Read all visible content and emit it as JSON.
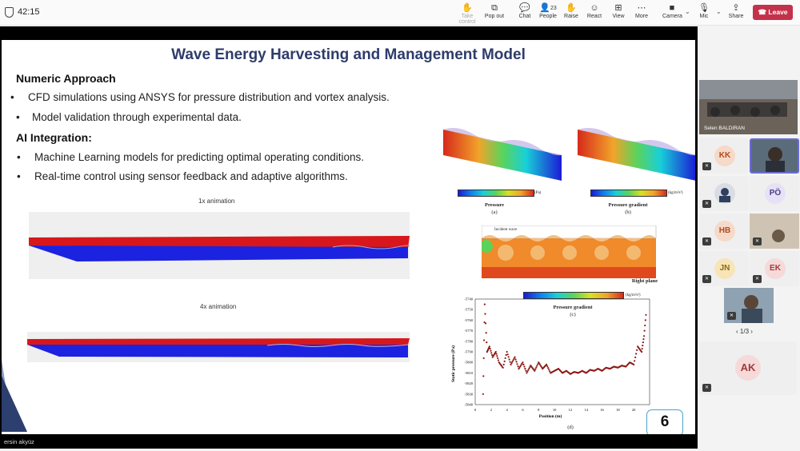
{
  "topbar": {
    "timer": "42:15",
    "take_control": "Take control",
    "pop_out": "Pop out",
    "chat": "Chat",
    "people": "People",
    "people_count": "23",
    "raise": "Raise",
    "react": "React",
    "view": "View",
    "more": "More",
    "camera": "Camera",
    "mic": "Mic",
    "share": "Share",
    "leave": "Leave"
  },
  "slide": {
    "title": "Wave Energy Harvesting and Management Model",
    "section1": "Numeric Approach",
    "bullets1": [
      "CFD simulations using ANSYS for pressure distribution and vortex analysis.",
      "Model validation through experimental data."
    ],
    "section2": "AI Integration:",
    "bullets2": [
      "Machine Learning models for predicting optimal operating conditions.",
      "Real-time control using sensor feedback and adaptive algorithms."
    ],
    "anim1_label": "1x animation",
    "anim2_label": "4x animation",
    "page_number": "6",
    "figure": {
      "pressure_caption": "Pressure",
      "pressure_sub": "(a)",
      "pressure_unit": "(Pa)",
      "gradient_caption": "Pressure gradient",
      "gradient_sub": "(b)",
      "gradient_unit": "(kg/m²s²)",
      "incident_wave": "Incident wave",
      "right_plane": "Right plane",
      "gradient_caption_c": "Pressure gradient",
      "sub_c": "(c)",
      "unit_c": "(kg/m²s²)",
      "y_label": "Static pressure (Pa)",
      "x_label": "Position (m)",
      "sub_d": "(d)",
      "y_ticks": [
        "-5740",
        "-5750",
        "-5760",
        "-5770",
        "-5780",
        "-5790",
        "-5800",
        "-5810",
        "-5820",
        "-5830",
        "-5840"
      ],
      "x_ticks": [
        "0",
        "2",
        "4",
        "6",
        "8",
        "10",
        "12",
        "14",
        "16",
        "18",
        "20"
      ]
    }
  },
  "presenter_name": "ersin akyüz",
  "participants": {
    "main_video_name": "Selen BALDIRAN",
    "tiles": [
      {
        "initials": "KK",
        "bg": "#f6d9c8",
        "fg": "#b04a1e"
      },
      {
        "initials": "PÖ",
        "bg": "#e6e1f5",
        "fg": "#4b3d8f"
      },
      {
        "initials": "HB",
        "bg": "#f6d9c8",
        "fg": "#b04a1e"
      },
      {
        "initials": "JN",
        "bg": "#f7e5b8",
        "fg": "#8a6a12"
      },
      {
        "initials": "EK",
        "bg": "#f6d9d9",
        "fg": "#a33a3a"
      },
      {
        "initials": "AK",
        "bg": "#f6d9d9",
        "fg": "#a33a3a"
      }
    ],
    "pager": "1/3"
  },
  "chart_data": {
    "type": "scatter",
    "xlabel": "Position (m)",
    "ylabel": "Static pressure (Pa)",
    "xlim": [
      0,
      22
    ],
    "ylim": [
      -5840,
      -5740
    ],
    "series": [
      {
        "x": [
          1.0,
          1.2,
          1.5,
          1.8,
          2.2,
          2.6,
          3.0,
          3.5,
          4.0,
          4.5,
          5.0,
          5.5,
          6.0,
          6.5,
          7.0,
          7.5,
          8.0,
          8.5,
          9.0,
          9.5,
          10.0,
          10.5,
          11.0,
          11.5,
          12.0,
          12.5,
          13.0,
          13.5,
          14.0,
          14.5,
          15.0,
          15.5,
          16.0,
          16.5,
          17.0,
          17.5,
          18.0,
          18.5,
          19.0,
          19.5,
          20.0,
          20.5,
          21.0,
          21.3,
          21.6
        ],
        "y": [
          -5830,
          -5745,
          -5790,
          -5785,
          -5795,
          -5790,
          -5800,
          -5805,
          -5790,
          -5802,
          -5795,
          -5806,
          -5800,
          -5810,
          -5803,
          -5808,
          -5800,
          -5806,
          -5802,
          -5810,
          -5808,
          -5806,
          -5810,
          -5808,
          -5811,
          -5809,
          -5810,
          -5808,
          -5810,
          -5807,
          -5808,
          -5806,
          -5808,
          -5805,
          -5806,
          -5804,
          -5805,
          -5803,
          -5804,
          -5800,
          -5802,
          -5785,
          -5790,
          -5775,
          -5750
        ]
      }
    ]
  }
}
